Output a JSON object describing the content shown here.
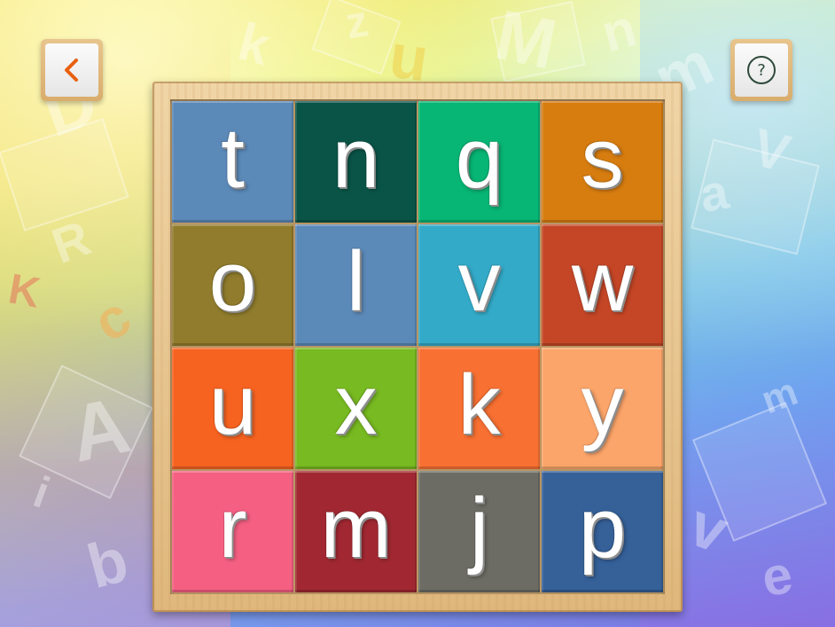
{
  "buttons": {
    "back_glyph": "<",
    "help_glyph": "?"
  },
  "background_letters": [
    "D",
    "k",
    "z",
    "u",
    "M",
    "n",
    "m",
    "R",
    "K",
    "c",
    "A",
    "i",
    "b",
    "a",
    "V",
    "m",
    "v",
    "e"
  ],
  "board": {
    "tiles": [
      {
        "letter": "t",
        "color": "#5b89b8"
      },
      {
        "letter": "n",
        "color": "#0a5447"
      },
      {
        "letter": "q",
        "color": "#07b574"
      },
      {
        "letter": "s",
        "color": "#d77d10"
      },
      {
        "letter": "o",
        "color": "#907c2c"
      },
      {
        "letter": "l",
        "color": "#5b89b8"
      },
      {
        "letter": "v",
        "color": "#33aac8"
      },
      {
        "letter": "w",
        "color": "#c44626"
      },
      {
        "letter": "u",
        "color": "#f66220"
      },
      {
        "letter": "x",
        "color": "#78ba21"
      },
      {
        "letter": "k",
        "color": "#f87032"
      },
      {
        "letter": "y",
        "color": "#fca56a"
      },
      {
        "letter": "r",
        "color": "#f55f82"
      },
      {
        "letter": "m",
        "color": "#a12832"
      },
      {
        "letter": "j",
        "color": "#6c6c64"
      },
      {
        "letter": "p",
        "color": "#356098"
      }
    ]
  }
}
